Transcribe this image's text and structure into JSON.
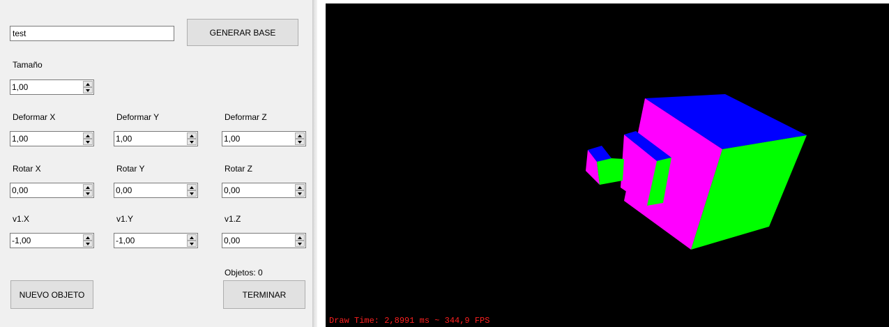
{
  "form": {
    "name_value": "test",
    "generate_label": "GENERAR BASE",
    "size_label": "Tamaño",
    "size_value": "1,00",
    "deform_x_label": "Deformar X",
    "deform_x_value": "1,00",
    "deform_y_label": "Deformar Y",
    "deform_y_value": "1,00",
    "deform_z_label": "Deformar Z",
    "deform_z_value": "1,00",
    "rotate_x_label": "Rotar X",
    "rotate_x_value": "0,00",
    "rotate_y_label": "Rotar Y",
    "rotate_y_value": "0,00",
    "rotate_z_label": "Rotar Z",
    "rotate_z_value": "0,00",
    "v1x_label": "v1.X",
    "v1x_value": "-1,00",
    "v1y_label": "v1.Y",
    "v1y_value": "-1,00",
    "v1z_label": "v1.Z",
    "v1z_value": "0,00",
    "objects_label": "Objetos: 0",
    "new_object_label": "NUEVO OBJETO",
    "finish_label": "TERMINAR"
  },
  "viewport": {
    "status_text": "Draw Time: 2,8991 ms ~ 344,9 FPS",
    "background": "#000000",
    "face_colors": {
      "top": "#0000ff",
      "left": "#ff00ff",
      "right": "#00ff00"
    },
    "status_color": "#ff2020"
  }
}
